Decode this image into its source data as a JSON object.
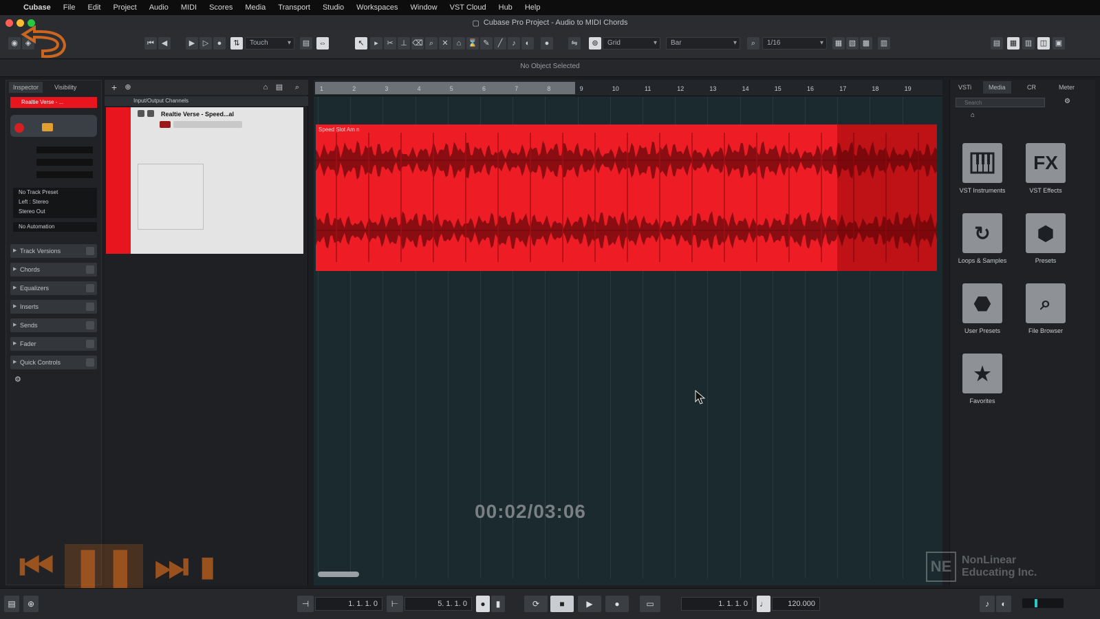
{
  "menubar": {
    "apple": "",
    "items": [
      "Cubase",
      "File",
      "Edit",
      "Project",
      "Audio",
      "MIDI",
      "Scores",
      "Media",
      "Transport",
      "Studio",
      "Workspaces",
      "Window",
      "VST Cloud",
      "Hub",
      "Help"
    ]
  },
  "window": {
    "title": "Cubase Pro Project - Audio to MIDI Chords"
  },
  "toolbar": {
    "automation_mode": "Touch",
    "snap_type": "Grid",
    "grid_type": "Bar",
    "quantize": "1/16"
  },
  "infobar": {
    "text": "No Object Selected"
  },
  "inspector": {
    "tabs": [
      "Inspector",
      "Visibility"
    ],
    "track_name": "Realtie Verse - ...",
    "routing": [
      "No Track Preset",
      "Left : Stereo",
      "Stereo Out"
    ],
    "no_automation": "No Automation",
    "sections": [
      "Track Versions",
      "Chords",
      "Equalizers",
      "Inserts",
      "Sends",
      "Fader",
      "Quick Controls"
    ]
  },
  "tracklist": {
    "folder_name": "Input/Output Channels",
    "track_name": "Realtie Verse - Speed...al"
  },
  "ruler": {
    "ticks": [
      "1",
      "2",
      "3",
      "4",
      "5",
      "6",
      "7",
      "8",
      "9",
      "10",
      "11",
      "12",
      "13",
      "14",
      "15",
      "16",
      "17",
      "18",
      "19"
    ]
  },
  "clip": {
    "label": "Speed Slot Am n"
  },
  "overlay": {
    "timecode": "00:02/03:06"
  },
  "mediabay": {
    "tabs": [
      "VSTi",
      "Media",
      "CR",
      "Meter"
    ],
    "search_placeholder": "Search",
    "items": [
      {
        "label": "VST Instruments",
        "icon": "piano-keys-icon"
      },
      {
        "label": "VST Effects",
        "icon": "fx-icon"
      },
      {
        "label": "Loops & Samples",
        "icon": "loop-icon"
      },
      {
        "label": "Presets",
        "icon": "presets-icon"
      },
      {
        "label": "User Presets",
        "icon": "user-presets-icon"
      },
      {
        "label": "File Browser",
        "icon": "file-browser-icon"
      },
      {
        "label": "Favorites",
        "icon": "star-icon"
      }
    ]
  },
  "transport": {
    "left_locator": "1. 1. 1. 0",
    "right_locator": "5. 1. 1. 0",
    "position": "1. 1. 1. 0",
    "tempo": "120.000"
  },
  "watermark": {
    "line1": "NonLinear",
    "line2": "Educating Inc."
  },
  "colors": {
    "track_red": "#ee1c24",
    "accent_orange": "#ff7a1a"
  }
}
